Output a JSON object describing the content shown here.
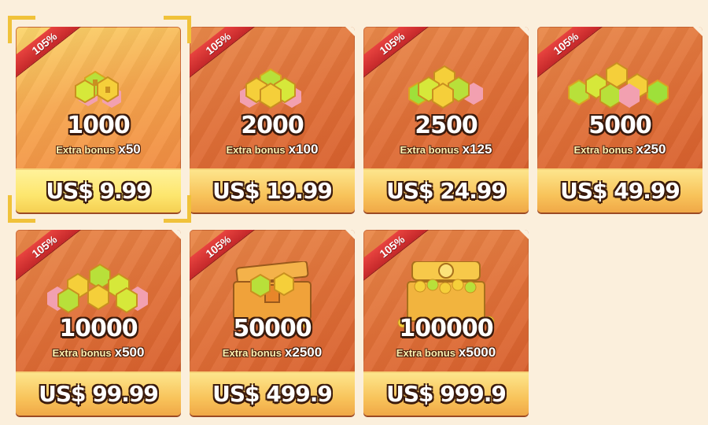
{
  "shop": {
    "selected_index": 0,
    "packs": [
      {
        "badge": "105%",
        "amount": "1000",
        "bonus_label": "Extra bonus",
        "bonus_mult": "x50",
        "price": "US$ 9.99",
        "art": "coin-pile-small-icon"
      },
      {
        "badge": "105%",
        "amount": "2000",
        "bonus_label": "Extra bonus",
        "bonus_mult": "x100",
        "price": "US$ 19.99",
        "art": "coin-pile-medium-icon"
      },
      {
        "badge": "105%",
        "amount": "2500",
        "bonus_label": "Extra bonus",
        "bonus_mult": "x125",
        "price": "US$ 24.99",
        "art": "coin-pile-medium-icon"
      },
      {
        "badge": "105%",
        "amount": "5000",
        "bonus_label": "Extra bonus",
        "bonus_mult": "x250",
        "price": "US$ 49.99",
        "art": "coin-pile-large-icon"
      },
      {
        "badge": "105%",
        "amount": "10000",
        "bonus_label": "Extra bonus",
        "bonus_mult": "x500",
        "price": "US$ 99.99",
        "art": "coin-pile-large-icon"
      },
      {
        "badge": "105%",
        "amount": "50000",
        "bonus_label": "Extra bonus",
        "bonus_mult": "x2500",
        "price": "US$ 499.9",
        "art": "treasure-chest-icon"
      },
      {
        "badge": "105%",
        "amount": "100000",
        "bonus_label": "Extra bonus",
        "bonus_mult": "x5000",
        "price": "US$ 999.9",
        "art": "gold-treasure-chest-icon"
      }
    ]
  },
  "colors": {
    "background": "#fbefdc",
    "card": "#e07038",
    "ribbon": "#d8353a",
    "price_bar": "#f8c35a",
    "selection_bracket": "#f0c23a",
    "coin_green": "#9ee03a",
    "coin_gold": "#f2c230",
    "coin_pink": "#f2a0b0"
  }
}
